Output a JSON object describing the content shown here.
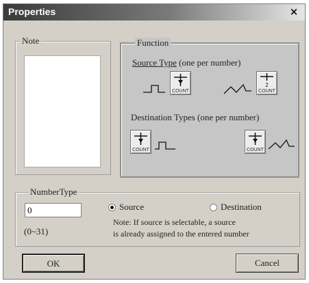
{
  "window": {
    "title": "Properties",
    "close_label": "×"
  },
  "note": {
    "legend": "Note",
    "value": ""
  },
  "function": {
    "legend": "Function",
    "source_type_underlined": "Source Type",
    "source_type_rest": " (one per number)",
    "destination_types_label": "Destination Types (one per number)",
    "icons": [
      {
        "text": "COUNT",
        "icon": "count-icon"
      },
      {
        "text": "COUNT",
        "icon": "count-icon"
      },
      {
        "text": "COUNT",
        "icon": "count-icon"
      },
      {
        "text": "COUNT",
        "icon": "count-icon"
      }
    ]
  },
  "number_type": {
    "legend": "NumberType",
    "value": "0",
    "range": "(0~31)",
    "source_label": "Source",
    "destination_label": "Destination",
    "selected": "Source",
    "note_line1": "Note: If source is selectable, a source",
    "note_line2": "is already assigned to the entered number"
  },
  "buttons": {
    "ok": "OK",
    "cancel": "Cancel"
  },
  "colors": {
    "title_dark": "#3a3a3a",
    "dialog_face": "#d4d0c8",
    "function_panel": "#c6c6c6"
  }
}
